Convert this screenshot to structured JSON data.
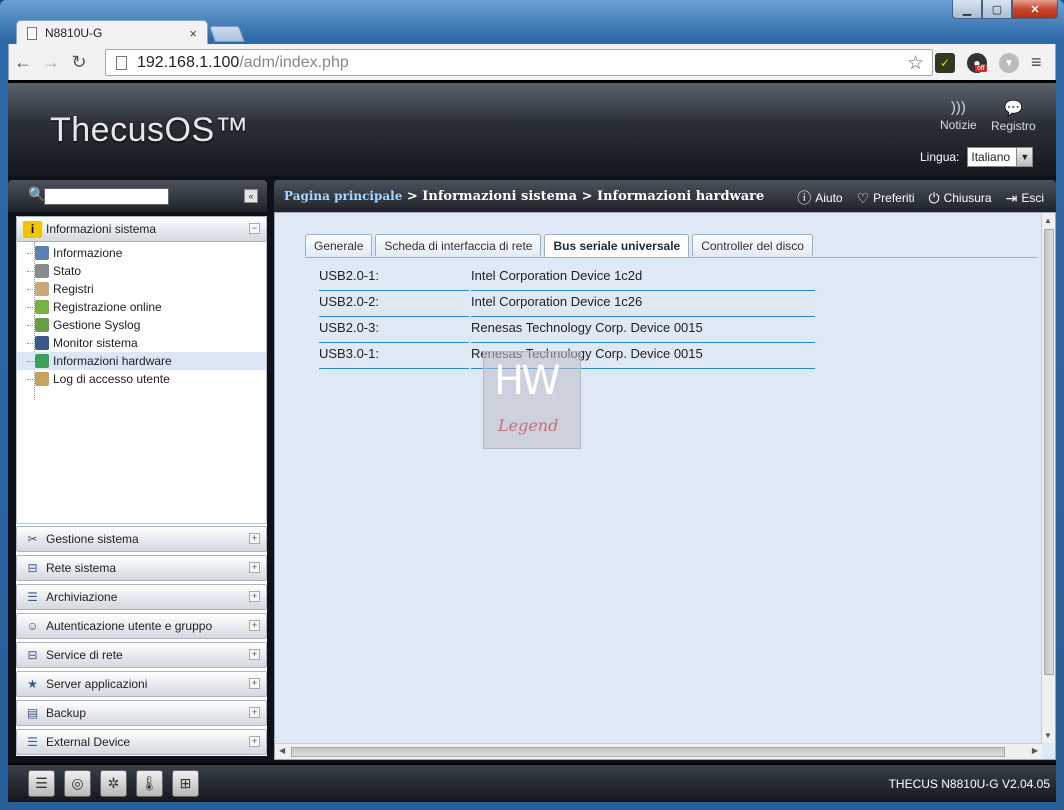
{
  "browser": {
    "tab_title": "N8810U-G",
    "tab_close": "×",
    "url_host": "192.168.1.100",
    "url_path": "/adm/index.php",
    "window_buttons": {
      "minimize": "▁",
      "maximize": "▢",
      "close": "✕"
    },
    "back": "←",
    "forward": "→",
    "reload": "↻",
    "menu": "≡",
    "star": "☆",
    "ext_off": "off"
  },
  "header": {
    "brand": "ThecusOS™",
    "notizie": "Notizie",
    "registro": "Registro",
    "language_label": "Lingua:",
    "language_value": "Italiano"
  },
  "sidebar": {
    "collapse": "«",
    "info_section": {
      "label": "Informazioni sistema",
      "toggle": "−"
    },
    "info_items": [
      {
        "label": "Informazione",
        "color": "#5a7fb0"
      },
      {
        "label": "Stato",
        "color": "#8a8a8a"
      },
      {
        "label": "Registri",
        "color": "#c8a878"
      },
      {
        "label": "Registrazione online",
        "color": "#7ab040"
      },
      {
        "label": "Gestione Syslog",
        "color": "#6a9a4a"
      },
      {
        "label": "Monitor sistema",
        "color": "#3a5a8a"
      },
      {
        "label": "Informazioni hardware",
        "color": "#3aa05a"
      },
      {
        "label": "Log di accesso utente",
        "color": "#c8a060"
      }
    ],
    "sections": [
      {
        "label": "Gestione sistema",
        "icon": "tools-icon"
      },
      {
        "label": "Rete sistema",
        "icon": "network-icon"
      },
      {
        "label": "Archiviazione",
        "icon": "storage-icon"
      },
      {
        "label": "Autenticazione utente e gruppo",
        "icon": "users-icon"
      },
      {
        "label": "Service di rete",
        "icon": "network-service-icon"
      },
      {
        "label": "Server applicazioni",
        "icon": "folder-star-icon"
      },
      {
        "label": "Backup",
        "icon": "backup-icon"
      },
      {
        "label": "External Device",
        "icon": "external-device-icon"
      }
    ],
    "plus": "+"
  },
  "breadcrumb": {
    "home": "Pagina principale",
    "sep": " > ",
    "level1": "Informazioni sistema",
    "level2": "Informazioni hardware"
  },
  "actions": {
    "help": "Aiuto",
    "favorites": "Preferiti",
    "shutdown": "Chiusura",
    "logout": "Esci"
  },
  "tabs": [
    "Generale",
    "Scheda di interfaccia di rete",
    "Bus seriale universale",
    "Controller del disco"
  ],
  "active_tab": 2,
  "usb": [
    {
      "port": "USB2.0-1:",
      "device": "Intel Corporation Device 1c2d"
    },
    {
      "port": "USB2.0-2:",
      "device": "Intel Corporation Device 1c26"
    },
    {
      "port": "USB2.0-3:",
      "device": "Renesas Technology Corp. Device 0015"
    },
    {
      "port": "USB3.0-1:",
      "device": "Renesas Technology Corp. Device 0015"
    }
  ],
  "watermark": {
    "mark": "HW",
    "word": "Legend"
  },
  "footer": {
    "version": "THECUS N8810U-G V2.04.05"
  }
}
